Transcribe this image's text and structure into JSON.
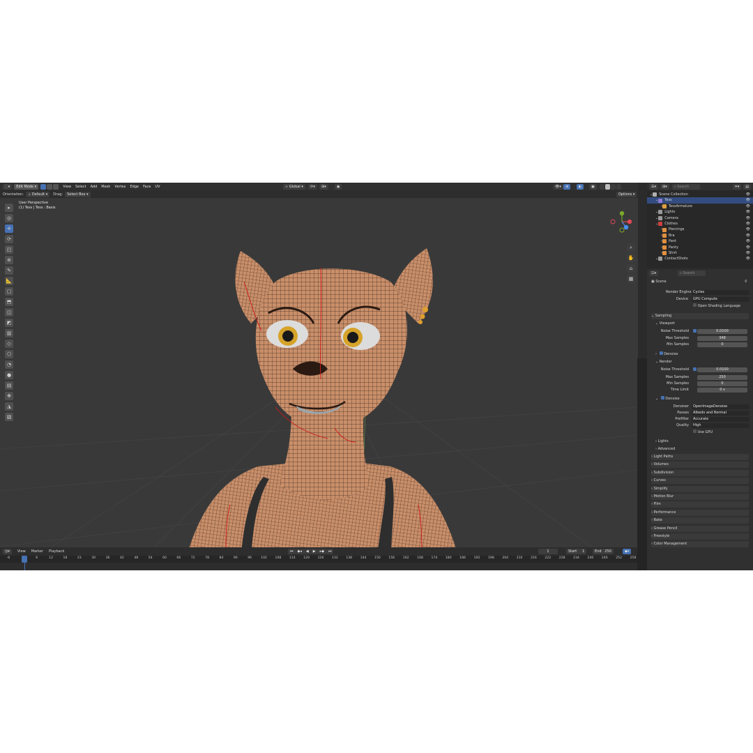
{
  "header": {
    "mode": "Edit Mode",
    "menu": [
      "View",
      "Select",
      "Add",
      "Mesh",
      "Vertex",
      "Edge",
      "Face",
      "UV"
    ],
    "transform_orientation": "Global",
    "options_label": "Options"
  },
  "tool_header": {
    "orientation_label": "Orientation:",
    "orientation_value": "Default",
    "drag_label": "Drag:",
    "drag_value": "Select Box"
  },
  "viewport": {
    "overlay_line1": "User Perspective",
    "overlay_line2": "(1) Tess | Tess : Basis",
    "gizmo_axes": [
      "X",
      "Y",
      "Z"
    ]
  },
  "outliner": {
    "search_placeholder": "Search",
    "items": [
      {
        "label": "Scene Collection",
        "indent": 0,
        "color": "#b0b0b0"
      },
      {
        "label": "Tess",
        "indent": 1,
        "color": "#8e7bd6"
      },
      {
        "label": "TessArmature",
        "indent": 2,
        "color": "#e0a040"
      },
      {
        "label": "Lights",
        "indent": 1,
        "color": "#9a9a9a"
      },
      {
        "label": "Camera",
        "indent": 1,
        "color": "#9a9a9a"
      },
      {
        "label": "Clothes",
        "indent": 1,
        "color": "#d04040"
      },
      {
        "label": "Piercings",
        "indent": 2,
        "color": "#e09040"
      },
      {
        "label": "Bra",
        "indent": 2,
        "color": "#e09040"
      },
      {
        "label": "Pant",
        "indent": 2,
        "color": "#e09040"
      },
      {
        "label": "Panty",
        "indent": 2,
        "color": "#e09040"
      },
      {
        "label": "Shirt",
        "indent": 2,
        "color": "#e09040"
      },
      {
        "label": "ContactShots",
        "indent": 1,
        "color": "#9a9a9a"
      }
    ]
  },
  "properties": {
    "search_placeholder": "Search",
    "context": "Scene",
    "render_engine_label": "Render Engine",
    "render_engine": "Cycles",
    "device_label": "Device",
    "device": "GPU Compute",
    "osl_label": "Open Shading Language",
    "sampling": "Sampling",
    "viewport": "Viewport",
    "noise_threshold_label": "Noise Threshold",
    "viewport_noise": "0.0100",
    "max_samples_label": "Max Samples",
    "viewport_max": "348",
    "min_samples_label": "Min Samples",
    "viewport_min": "0",
    "denoise": "Denoise",
    "render": "Render",
    "render_noise": "0.0100",
    "render_max": "250",
    "render_min": "0",
    "time_limit_label": "Time Limit",
    "time_limit": "0 s",
    "denoiser_label": "Denoiser",
    "denoiser": "OpenImageDenoise",
    "passes_label": "Passes",
    "passes": "Albedo and Normal",
    "prefilter_label": "Prefilter",
    "prefilter": "Accurate",
    "quality_label": "Quality",
    "quality": "High",
    "use_gpu": "Use GPU",
    "subsections": [
      "Lights",
      "Advanced"
    ],
    "panels": [
      "Light Paths",
      "Volumes",
      "Subdivision",
      "Curves",
      "Simplify",
      "Motion Blur",
      "Film",
      "Performance",
      "Bake",
      "Grease Pencil",
      "Freestyle",
      "Color Management"
    ]
  },
  "timeline": {
    "menu": [
      "View",
      "Marker",
      "Playback"
    ],
    "current_frame": "1",
    "start_label": "Start",
    "start": "1",
    "end_label": "End",
    "end": "250",
    "ticks": [
      "-6",
      "1",
      "6",
      "12",
      "18",
      "23",
      "30",
      "36",
      "42",
      "48",
      "54",
      "60",
      "66",
      "72",
      "78",
      "84",
      "90",
      "96",
      "102",
      "108",
      "114",
      "120",
      "126",
      "132",
      "138",
      "144",
      "150",
      "156",
      "162",
      "168",
      "174",
      "180",
      "186",
      "192",
      "198",
      "204",
      "210",
      "216",
      "222",
      "228",
      "234",
      "240",
      "246",
      "252",
      "258"
    ]
  },
  "colors": {
    "accent": "#4772b3",
    "skin": "#c98f6a",
    "wire": "#2a1a12",
    "seam": "#d01818",
    "earring": "#e0a030"
  }
}
